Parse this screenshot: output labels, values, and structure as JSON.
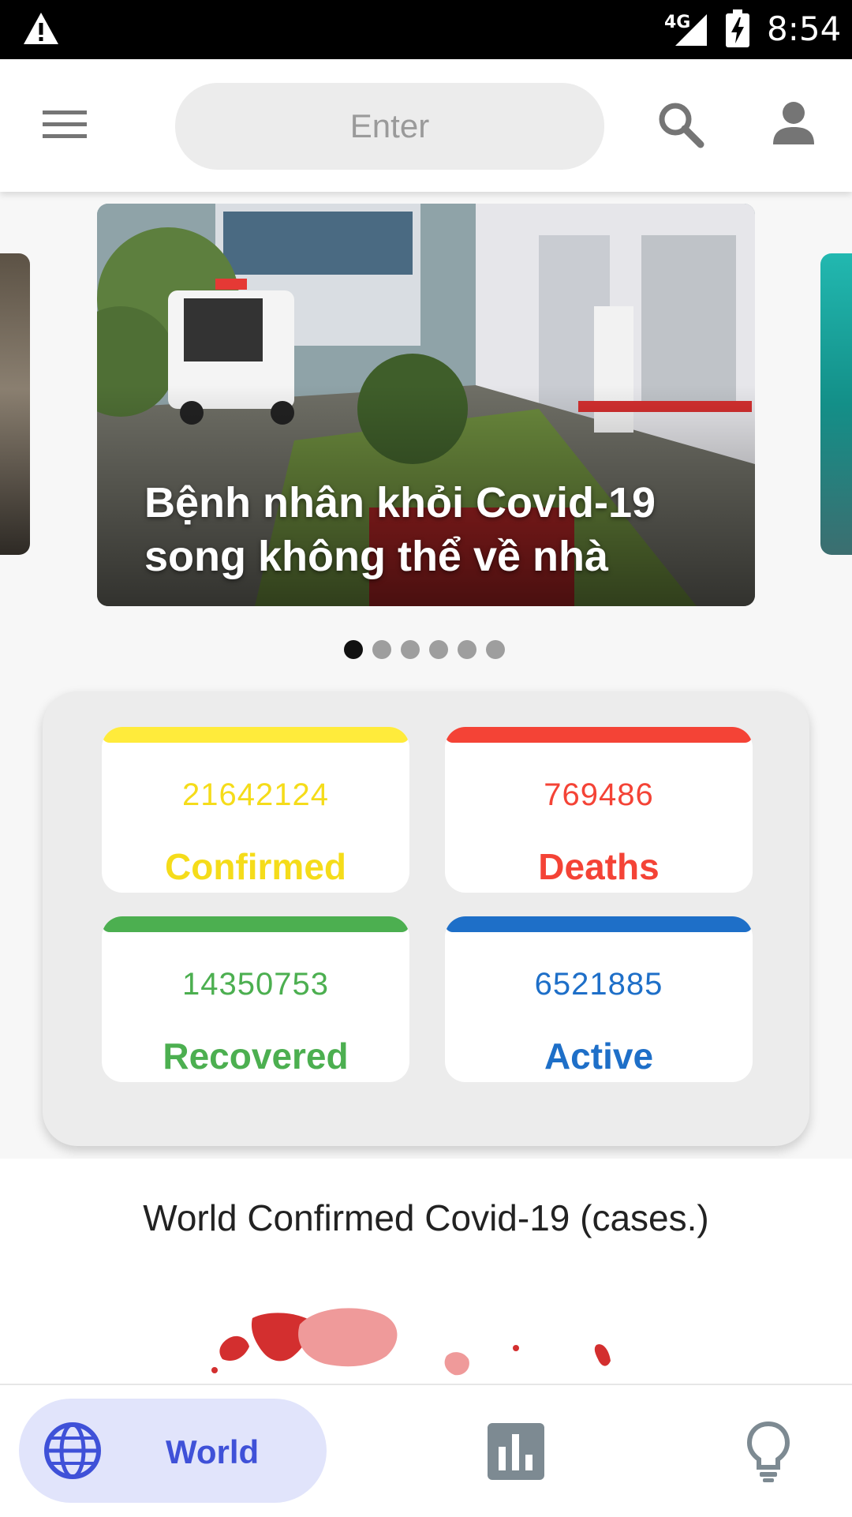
{
  "status_bar": {
    "network": "4G",
    "time": "8:54"
  },
  "header": {
    "search_placeholder": "Enter"
  },
  "carousel": {
    "headline": "Bệnh nhân khỏi Covid-19 song không thể về nhà",
    "page_count": 6,
    "active_index": 0
  },
  "stats": {
    "confirmed": {
      "value": "21642124",
      "label": "Confirmed",
      "color": "#ffeb3b"
    },
    "deaths": {
      "value": "769486",
      "label": "Deaths",
      "color": "#f44336"
    },
    "recovered": {
      "value": "14350753",
      "label": "Recovered",
      "color": "#4caf50"
    },
    "active": {
      "value": "6521885",
      "label": "Active",
      "color": "#1e6fc8"
    }
  },
  "world": {
    "title": "World Confirmed Covid-19 (cases.)"
  },
  "nav": {
    "world_label": "World",
    "active_color": "#3f51d8"
  },
  "icons": [
    "warning-icon",
    "signal-icon",
    "battery-charging-icon",
    "menu-icon",
    "search-icon",
    "account-icon",
    "globe-icon",
    "bar-chart-icon",
    "lightbulb-icon"
  ]
}
